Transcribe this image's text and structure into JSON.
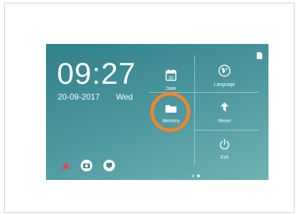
{
  "clock": {
    "time": "09:27",
    "date": "20-09-2017",
    "day": "Wed"
  },
  "menu": {
    "date": {
      "label": "Date",
      "calendar_day": "30"
    },
    "language": {
      "label": "Language"
    },
    "memory": {
      "label": "Memory"
    },
    "reset": {
      "label": "Reset"
    },
    "exit": {
      "label": "Exit"
    }
  },
  "pagination": {
    "page_count": 2,
    "active_page": 2
  },
  "colors": {
    "screen_top": "#2f7f8a",
    "screen_bottom": "#6fb3b2",
    "highlight": "#f0862c",
    "alert": "#e04848"
  },
  "icons": [
    "sd-card-icon",
    "calendar-icon",
    "globe-icon",
    "folder-icon",
    "reset-arrow-icon",
    "power-icon",
    "alert-triangle-icon",
    "camera-icon",
    "monitor-icon"
  ]
}
